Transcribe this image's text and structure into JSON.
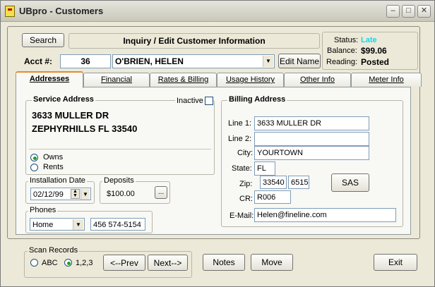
{
  "window": {
    "title": "UBpro - Customers",
    "min": "–",
    "max": "□",
    "close": "✕"
  },
  "header": {
    "search_label": "Search",
    "banner": "Inquiry / Edit Customer Information",
    "acct_label": "Acct #:",
    "acct_value": "36",
    "customer_name": "O'BRIEN, HELEN",
    "edit_name_label": "Edit Name"
  },
  "status": {
    "status_label": "Status:",
    "status_value": "Late",
    "balance_label": "Balance:",
    "balance_value": "$99.06",
    "reading_label": "Reading:",
    "reading_value": "Posted",
    "late_color": "#19d4e6"
  },
  "tabs": [
    "Addresses",
    "Financial",
    "Rates & Billing",
    "Usage History",
    "Other Info",
    "Meter Info"
  ],
  "service": {
    "title": "Service Address",
    "inactive_label": "Inactive",
    "line1": "3633 MULLER DR",
    "line2": "ZEPHYRHILLS FL 33540",
    "owns_label": "Owns",
    "rents_label": "Rents",
    "selected": "Owns"
  },
  "installation": {
    "title": "Installation Date",
    "value": "02/12/99"
  },
  "deposits": {
    "title": "Deposits",
    "value": "$100.00",
    "more": "..."
  },
  "phones": {
    "title": "Phones",
    "type": "Home",
    "number": "456 574-5154"
  },
  "billing": {
    "title": "Billing Address",
    "line1_label": "Line 1:",
    "line1": "3633 MULLER DR",
    "line2_label": "Line 2:",
    "line2": "",
    "city_label": "City:",
    "city": "YOURTOWN",
    "state_label": "State:",
    "state": "FL",
    "zip_label": "Zip:",
    "zip": "33540",
    "zip4": "6515",
    "cr_label": "CR:",
    "cr": "R006",
    "email_label": "E-Mail:",
    "email": "Helen@fineline.com",
    "sas_label": "SAS"
  },
  "scan": {
    "title": "Scan Records",
    "abc_label": "ABC",
    "num_label": "1,2,3",
    "selected": "1,2,3",
    "prev_label": "<--Prev",
    "next_label": "Next-->"
  },
  "footer": {
    "notes_label": "Notes",
    "move_label": "Move",
    "exit_label": "Exit"
  }
}
